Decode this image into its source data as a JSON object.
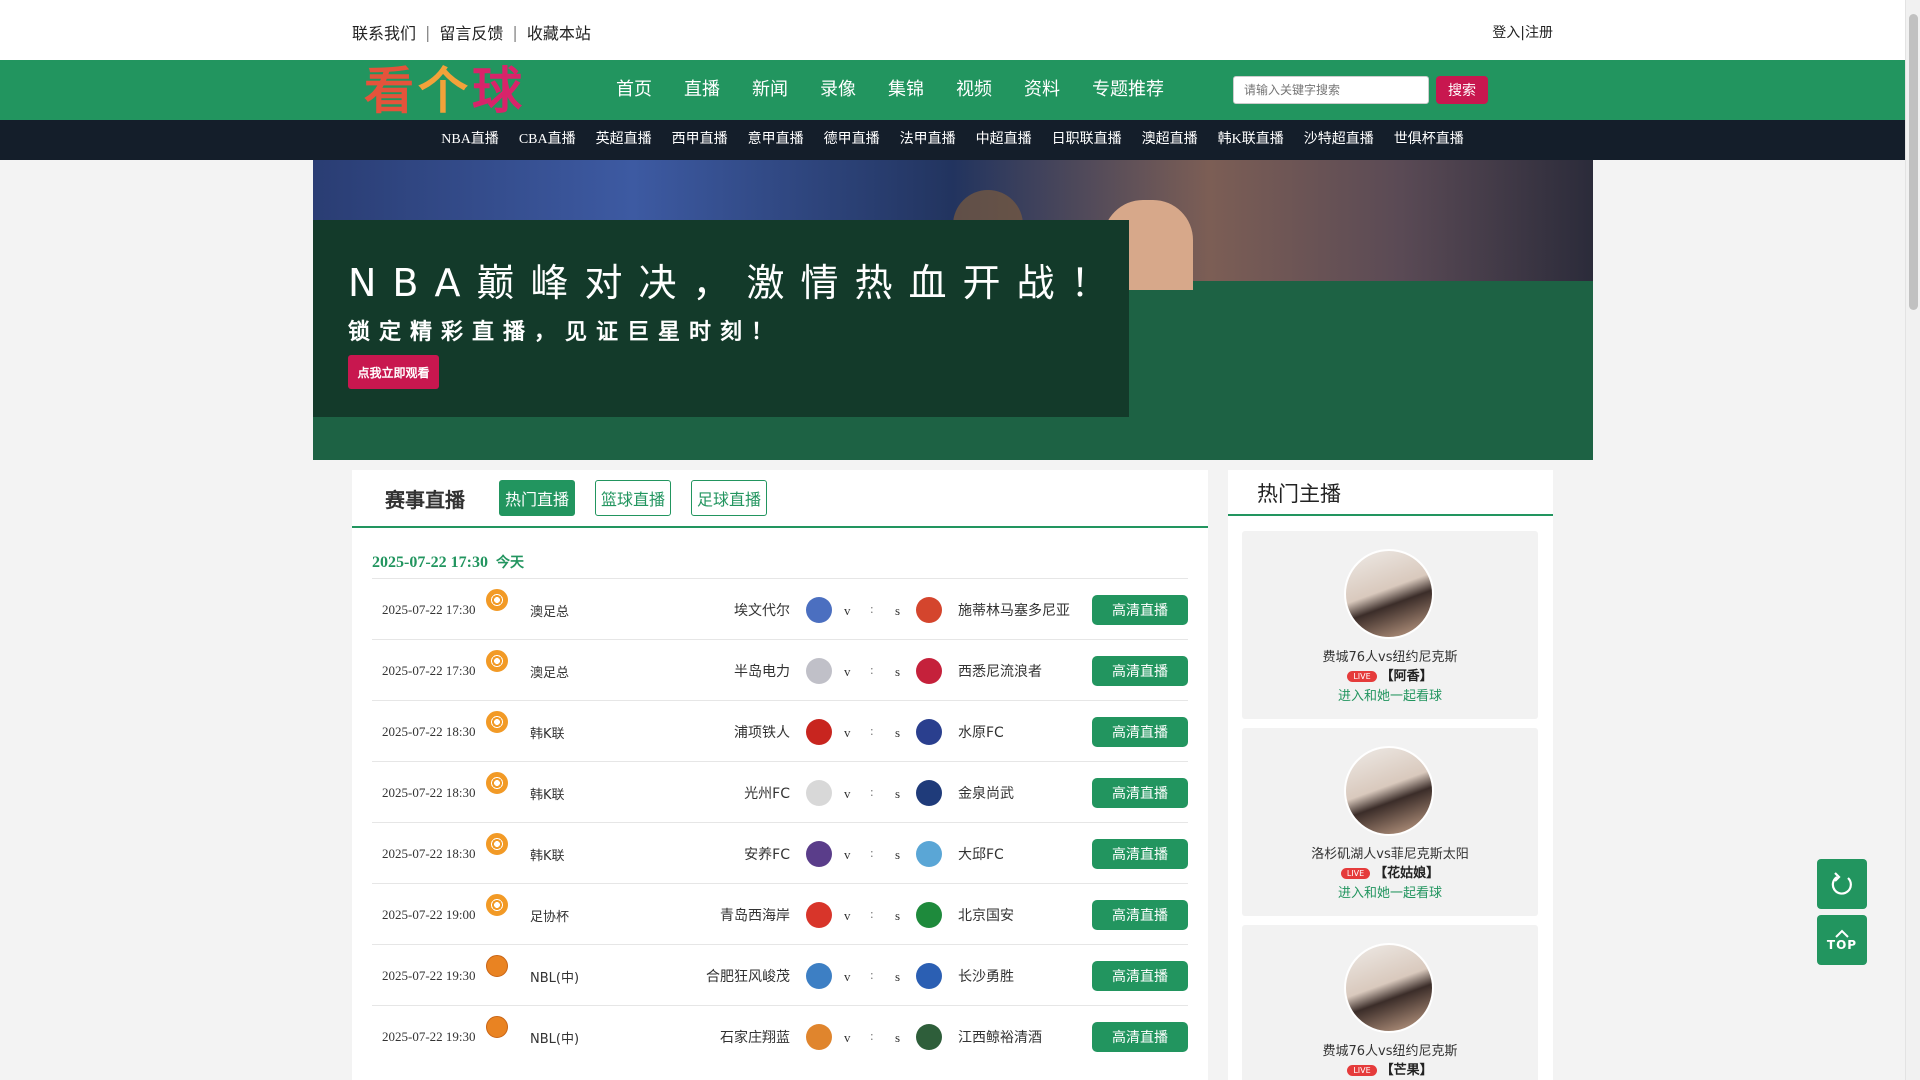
{
  "topbar": {
    "links": [
      "联系我们",
      "留言反馈",
      "收藏本站"
    ],
    "login": "登入|注册"
  },
  "logo": {
    "chars": [
      "看",
      "个",
      "球"
    ]
  },
  "nav": [
    "首页",
    "直播",
    "新闻",
    "录像",
    "集锦",
    "视频",
    "资料",
    "专题推荐"
  ],
  "search": {
    "placeholder": "请输入关键字搜索",
    "button": "搜索"
  },
  "subnav": [
    "NBA直播",
    "CBA直播",
    "英超直播",
    "西甲直播",
    "意甲直播",
    "德甲直播",
    "法甲直播",
    "中超直播",
    "日职联直播",
    "澳超直播",
    "韩K联直播",
    "沙特超直播",
    "世俱杯直播"
  ],
  "banner": {
    "headline": "NBA巅峰对决，激情热血开战！",
    "subline": "锁定精彩直播，见证巨星时刻！",
    "cta": "点我立即观看"
  },
  "live": {
    "title": "赛事直播",
    "tabs": [
      "热门直播",
      "篮球直播",
      "足球直播"
    ],
    "date": "2025-07-22 17:30",
    "today": "今天",
    "v": "v",
    "colon": ":",
    "s": "s",
    "matches": [
      {
        "time": "2025-07-22 17:30",
        "sport": "football",
        "league": "澳足总",
        "home": "埃文代尔",
        "away": "施蒂林马塞多尼亚",
        "home_color": "#4b6fc0",
        "away_color": "#d4452d",
        "button": "高清直播"
      },
      {
        "time": "2025-07-22 17:30",
        "sport": "football",
        "league": "澳足总",
        "home": "半岛电力",
        "away": "西悉尼流浪者",
        "home_color": "#c0c0c8",
        "away_color": "#c5213b",
        "button": "高清直播"
      },
      {
        "time": "2025-07-22 18:30",
        "sport": "football",
        "league": "韩K联",
        "home": "浦项铁人",
        "away": "水原FC",
        "home_color": "#c8251f",
        "away_color": "#2a3f8e",
        "button": "高清直播"
      },
      {
        "time": "2025-07-22 18:30",
        "sport": "football",
        "league": "韩K联",
        "home": "光州FC",
        "away": "金泉尚武",
        "home_color": "#d8d8d8",
        "away_color": "#1f3b7a",
        "button": "高清直播"
      },
      {
        "time": "2025-07-22 18:30",
        "sport": "football",
        "league": "韩K联",
        "home": "安养FC",
        "away": "大邱FC",
        "home_color": "#5a3d8a",
        "away_color": "#5aa6d6",
        "button": "高清直播"
      },
      {
        "time": "2025-07-22 19:00",
        "sport": "football",
        "league": "足协杯",
        "home": "青岛西海岸",
        "away": "北京国安",
        "home_color": "#d8352a",
        "away_color": "#1e8a3c",
        "button": "高清直播"
      },
      {
        "time": "2025-07-22 19:30",
        "sport": "basketball",
        "league": "NBL(中)",
        "home": "合肥狂风峻茂",
        "away": "长沙勇胜",
        "home_color": "#3d7fc4",
        "away_color": "#2b5fb3",
        "button": "高清直播"
      },
      {
        "time": "2025-07-22 19:30",
        "sport": "basketball",
        "league": "NBL(中)",
        "home": "石家庄翔蓝",
        "away": "江西鲸裕清酒",
        "home_color": "#e0852d",
        "away_color": "#2e5e3a",
        "button": "高清直播"
      }
    ]
  },
  "anchors": {
    "title": "热门主播",
    "live_tag": "LIVE",
    "enter": "进入和她一起看球",
    "items": [
      {
        "match": "费城76人vs纽约尼克斯",
        "name": "【阿香】"
      },
      {
        "match": "洛杉矶湖人vs菲尼克斯太阳",
        "name": "【花姑娘】"
      },
      {
        "match": "费城76人vs纽约尼克斯",
        "name": "【芒果】"
      }
    ]
  },
  "float": {
    "top": "TOP"
  }
}
